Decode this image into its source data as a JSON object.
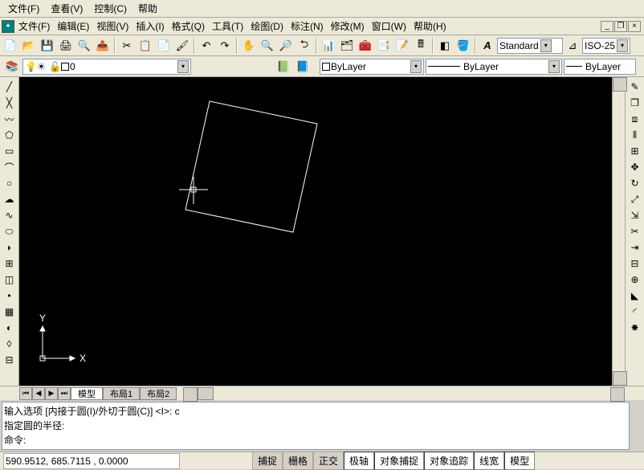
{
  "topmenu": {
    "file": "文件(F)",
    "view": "查看(V)",
    "control": "控制(C)",
    "help": "帮助"
  },
  "mainmenu": {
    "file": "文件(F)",
    "edit": "编辑(E)",
    "view": "视图(V)",
    "insert": "插入(I)",
    "format": "格式(Q)",
    "tools": "工具(T)",
    "draw": "绘图(D)",
    "dimension": "标注(N)",
    "modify": "修改(M)",
    "window": "窗口(W)",
    "help": "帮助(H)"
  },
  "style": {
    "text": "Standard",
    "dim": "ISO-25"
  },
  "layer": {
    "name": "0",
    "color": "ByLayer",
    "linetype": "ByLayer",
    "lw": "ByLayer"
  },
  "tabs": {
    "model": "模型",
    "layout1": "布局1",
    "layout2": "布局2"
  },
  "cmd": {
    "l1": "输入选项 [内接于圆(I)/外切于圆(C)] <I>: c",
    "l2": "指定圆的半径:",
    "l3": "命令:"
  },
  "status": {
    "coord": "590.9512, 685.7115 , 0.0000",
    "snap": "捕捉",
    "grid": "栅格",
    "ortho": "正交",
    "polar": "极轴",
    "osnap": "对象捕捉",
    "otrack": "对象追踪",
    "lw": "线宽",
    "model": "模型"
  },
  "axis": {
    "x": "X",
    "y": "Y"
  },
  "chart_data": null
}
